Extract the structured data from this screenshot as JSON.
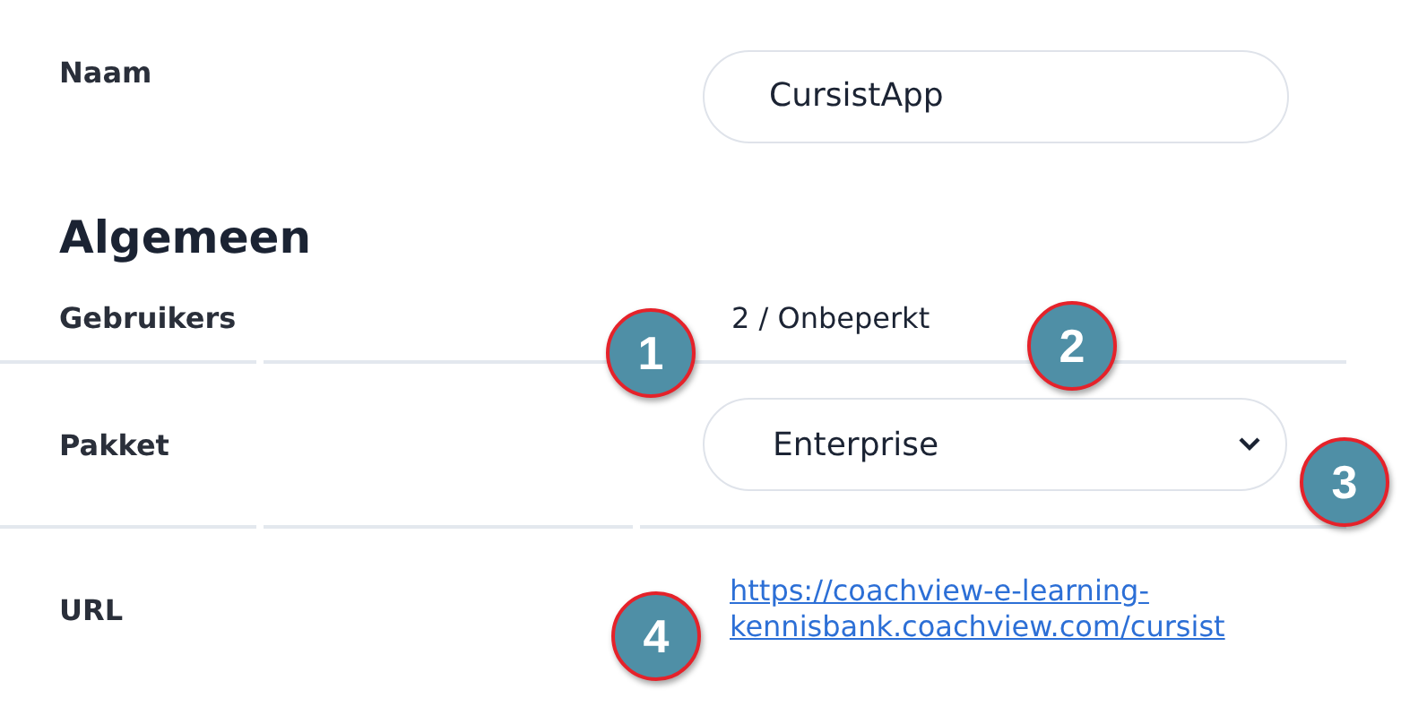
{
  "name_field": {
    "label": "Naam",
    "value": "CursistApp"
  },
  "section": {
    "title": "Algemeen"
  },
  "rows": [
    {
      "kind": "text",
      "label": "Gebruikers",
      "value": "2 / Onbeperkt"
    },
    {
      "kind": "select",
      "label": "Pakket",
      "value": "Enterprise"
    },
    {
      "kind": "link",
      "label": "URL",
      "value": "https://coachview-e-learning-kennisbank.coachview.com/cursist"
    }
  ],
  "callouts": [
    "1",
    "2",
    "3",
    "4"
  ]
}
